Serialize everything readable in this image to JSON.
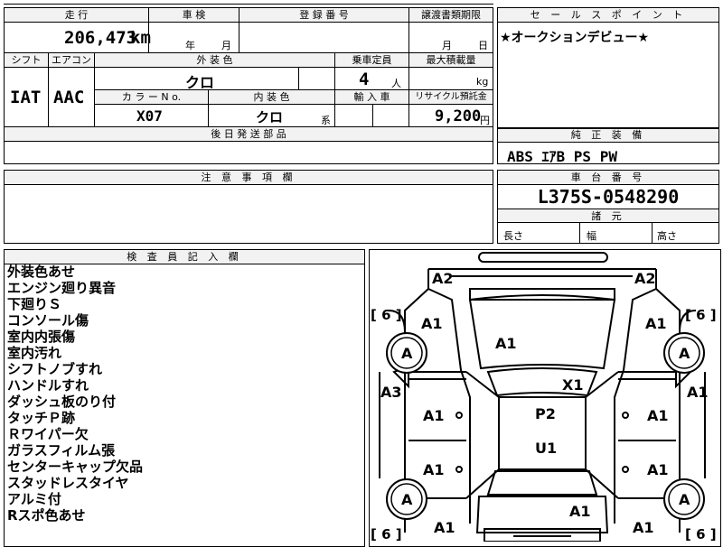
{
  "top_info": {
    "h_mileage": "走 行",
    "h_inspection": "車 検",
    "h_registration": "登 録 番 号",
    "h_transfer": "譲渡書類期限",
    "mileage_value": "206,473",
    "mileage_unit": "km",
    "year_unit": "年",
    "month_unit": "月",
    "transfer_month": "月",
    "transfer_day": "日",
    "h_shift": "シフト",
    "h_aircon": "エアコン",
    "h_ext_color": "外 装 色",
    "h_capacity": "乗車定員",
    "h_max_load": "最大積載量",
    "shift_value": "IAT",
    "aircon_value": "AAC",
    "ext_color_value": "クロ",
    "capacity_value": "4",
    "capacity_unit": "人",
    "load_unit": "kg",
    "h_color_no": "カ ラ ー N o.",
    "h_int_color": "内 装 色",
    "h_import": "輸 入 車",
    "h_recycle": "リサイクル預託金",
    "color_no_value": "X07",
    "int_color_value": "クロ",
    "int_color_suffix": "系",
    "recycle_value": "9,200",
    "recycle_unit": "円",
    "h_later_parts": "後 日 発 送 部 品"
  },
  "sales_point": {
    "header": "セ ー ル ス ポ イ ン ト",
    "text": "★オークションデビュー★"
  },
  "standard_equipment": {
    "header": "純 正 装 備",
    "text": "ABS ｴｱB PS PW"
  },
  "caution": {
    "header": "注 意 事 項 欄"
  },
  "chassis": {
    "header": "車 台 番 号",
    "value": "L375S-0548290",
    "dims_header": "諸 元",
    "length_label": "長さ",
    "width_label": "幅",
    "height_label": "高さ"
  },
  "inspector": {
    "header": "検 査 員 記 入 欄",
    "notes": [
      "外装色あせ",
      "エンジン廻り異音",
      "下廻りＳ",
      "コンソール傷",
      "室内内張傷",
      "室内汚れ",
      "シフトノブすれ",
      "ハンドルすれ",
      "ダッシュ板のり付",
      "タッチＰ跡",
      "Ｒワイパー欠",
      "ガラスフィルム張",
      "センターキャップ欠品",
      "スタッドレスタイヤ",
      "アルミ付",
      "Rスポ色あせ"
    ]
  },
  "diagram": {
    "marks": {
      "a2_left": "A2",
      "a2_right": "A2",
      "a1_fl_fender": "A1",
      "a1_fr_fender": "A1",
      "a1_hood": "A1",
      "a3_left": "A3",
      "a1_right_side": "A1",
      "x1": "X1",
      "p2": "P2",
      "u1": "U1",
      "a1_left_front_door": "A1",
      "a1_right_front_door": "A1",
      "a1_left_rear_door": "A1",
      "a1_right_rear_door": "A1",
      "a1_rear_center": "A1",
      "a1_rl": "A1",
      "a1_rr": "A1"
    },
    "tires": {
      "fl": "A",
      "fr": "A",
      "rl": "A",
      "rr": "A"
    },
    "tread": {
      "fl": "[ 6 ]",
      "fr": "[ 6 ]",
      "rl": "[ 6 ]",
      "rr": "[ 6 ]"
    }
  }
}
